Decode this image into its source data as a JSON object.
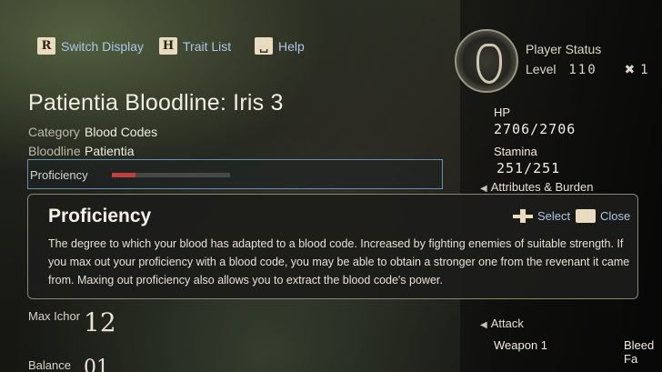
{
  "hints": {
    "switch_key": "R",
    "switch_label": "Switch Display",
    "trait_key": "H",
    "trait_label": "Trait List",
    "help_label": "Help"
  },
  "blood_code": {
    "name": "Patientia Bloodline: Iris 3",
    "category_label": "Category",
    "category_value": "Blood Codes",
    "bloodline_label": "Bloodline",
    "bloodline_value": "Patientia",
    "proficiency_label": "Proficiency",
    "proficiency_fraction": 0.2
  },
  "tooltip": {
    "title": "Proficiency",
    "select_label": "Select",
    "close_label": "Close",
    "description": "The degree to which your blood has adapted to a blood code. Increased by fighting enemies of suitable strength. If you max out your proficiency with a blood code, you may be able to obtain a stronger one from the revenant it came from. Maxing out proficiency also allows you to extract the blood code's power."
  },
  "left_stats": {
    "max_ichor_label": "Max Ichor",
    "max_ichor_value": "12",
    "balance_label": "Balance",
    "balance_value": "01"
  },
  "player_status": {
    "title": "Player Status",
    "level_label": "Level",
    "level_value": "110",
    "extra_value": "1",
    "hp_label": "HP",
    "hp_value": "2706/2706",
    "stamina_label": "Stamina",
    "stamina_value": "251/251",
    "attributes_label": "Attributes & Burden",
    "attack_label": "Attack",
    "weapon_label": "Weapon 1",
    "bleed_label": "Bleed Fa"
  }
}
